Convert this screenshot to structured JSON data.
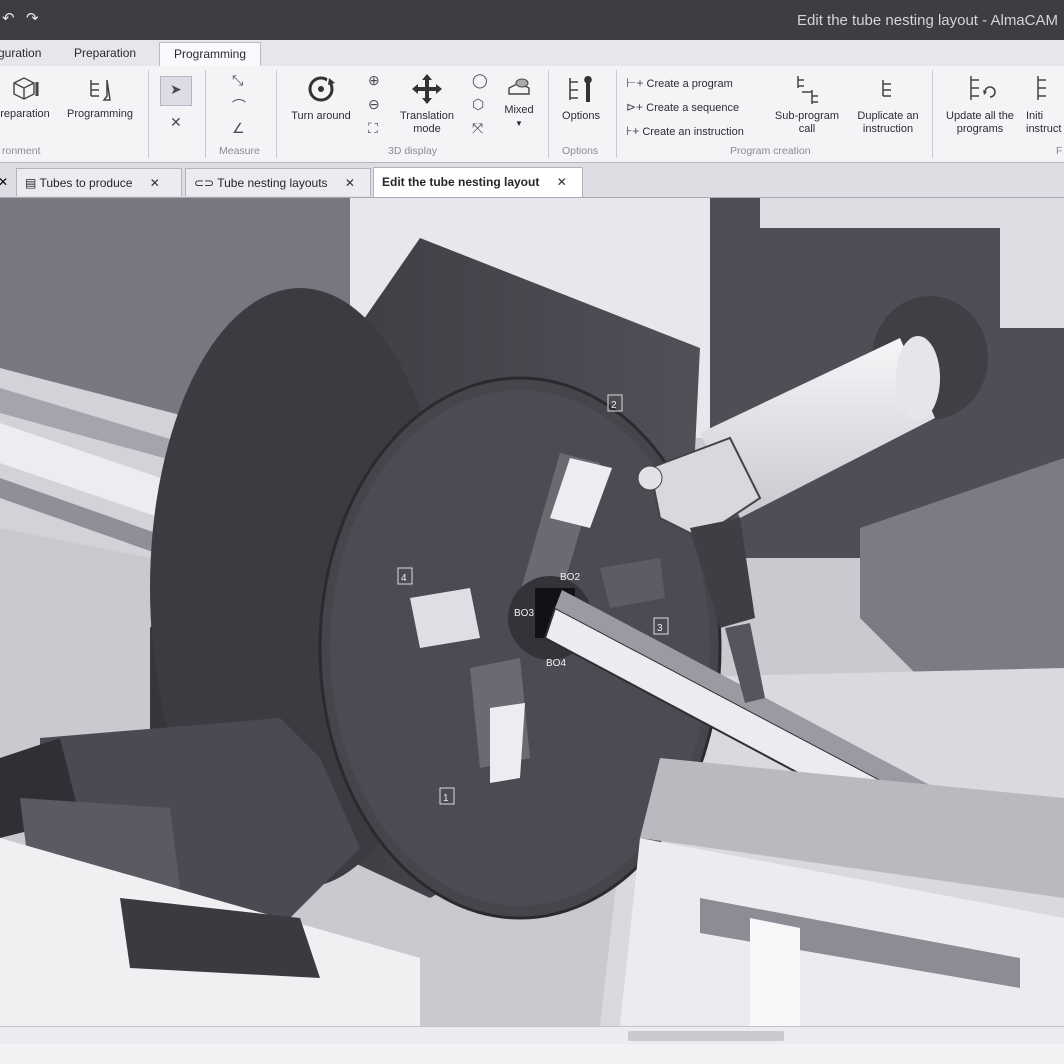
{
  "window": {
    "title": "Edit the tube nesting layout - AlmaCAM"
  },
  "quick_access": {
    "undo_icon": "undo-icon",
    "redo_icon": "redo-icon"
  },
  "ribbon_tabs": [
    "guration",
    "Preparation",
    "Programming"
  ],
  "ribbon": {
    "environment": {
      "group_label": "ronment",
      "preparation": "reparation",
      "programming": "Programming"
    },
    "measure": {
      "group_label": "Measure"
    },
    "display3d": {
      "group_label": "3D display",
      "turn_around": "Turn around",
      "translation_mode": "Translation mode",
      "mixed": "Mixed"
    },
    "options": {
      "group_label": "Options",
      "options": "Options"
    },
    "program_creation": {
      "group_label": "Program creation",
      "create_program": "Create a program",
      "create_sequence": "Create a sequence",
      "create_instruction": "Create an instruction",
      "sub_program_call": "Sub-program call",
      "duplicate_instruction": "Duplicate an instruction"
    },
    "last_group": {
      "update_all": "Update all the programs",
      "initial": "Initi instruct",
      "group_label": "F"
    }
  },
  "doc_tabs": {
    "tubes_to_produce": "Tubes to produce",
    "tube_nesting_layouts": "Tube nesting layouts",
    "edit_layout": "Edit the tube nesting layout",
    "close_symbol": "✕"
  },
  "scene": {
    "chuck_labels": [
      "2",
      "4",
      "1",
      "3"
    ],
    "jaw_labels": [
      "BO2",
      "BO3",
      "BO4"
    ]
  }
}
